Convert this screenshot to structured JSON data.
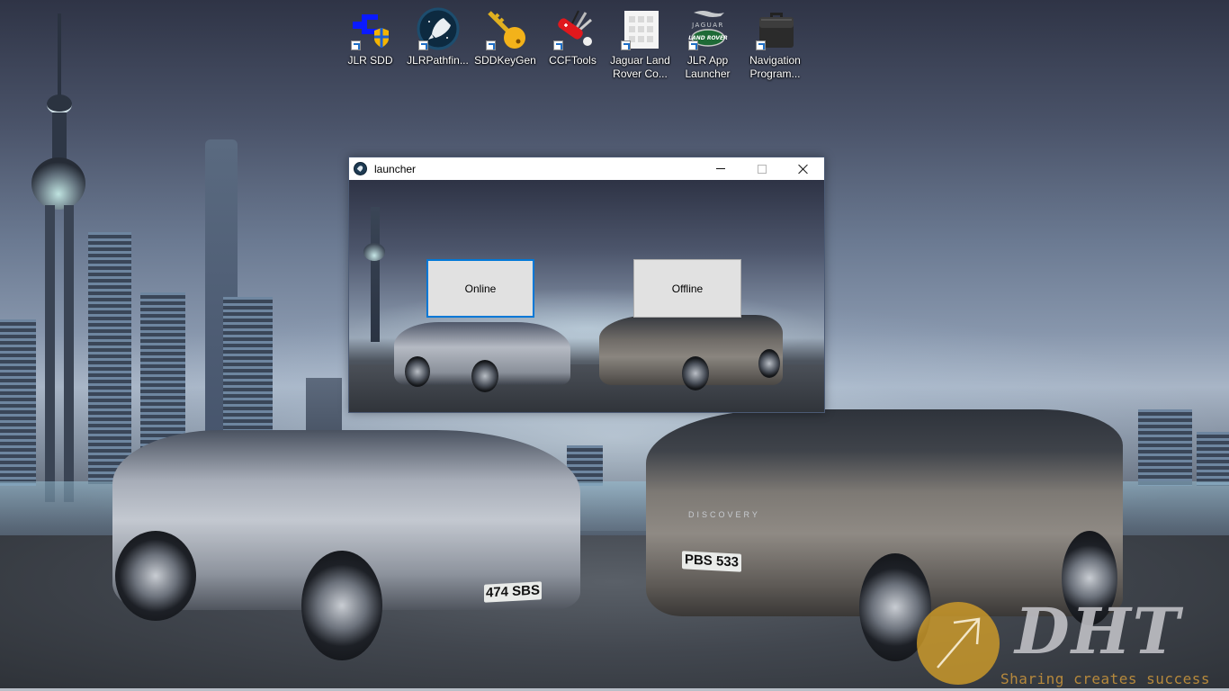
{
  "desktop": {
    "icons": [
      {
        "label": "JLR SDD",
        "icon": "jlr-sdd-icon",
        "shortcut": true
      },
      {
        "label": "JLRPathfin...",
        "icon": "jlr-pathfinder-icon",
        "shortcut": true
      },
      {
        "label": "SDDKeyGen",
        "icon": "key-icon",
        "shortcut": true
      },
      {
        "label": "CCFTools",
        "icon": "swiss-knife-icon",
        "shortcut": true
      },
      {
        "label": "Jaguar Land Rover Co...",
        "icon": "app-grid-icon",
        "shortcut": true
      },
      {
        "label": "JLR App Launcher",
        "icon": "jaguar-landrover-logo-icon",
        "shortcut": true
      },
      {
        "label": "Navigation Program...",
        "icon": "briefcase-icon",
        "shortcut": true
      }
    ],
    "wallpaper": {
      "plates": {
        "jaguar": "474 SBS",
        "landrover": "PBS 533"
      },
      "badge": "DISCOVERY"
    },
    "watermark": {
      "brand": "DHT",
      "slogan": "Sharing creates success",
      "accent": "#d6a028"
    }
  },
  "window": {
    "title": "launcher",
    "controls": {
      "minimize": "Minimize",
      "maximize": "Maximize",
      "close": "Close"
    },
    "buttons": {
      "online": "Online",
      "offline": "Offline"
    },
    "focused_button": "online",
    "focus_color": "#0078d7"
  }
}
